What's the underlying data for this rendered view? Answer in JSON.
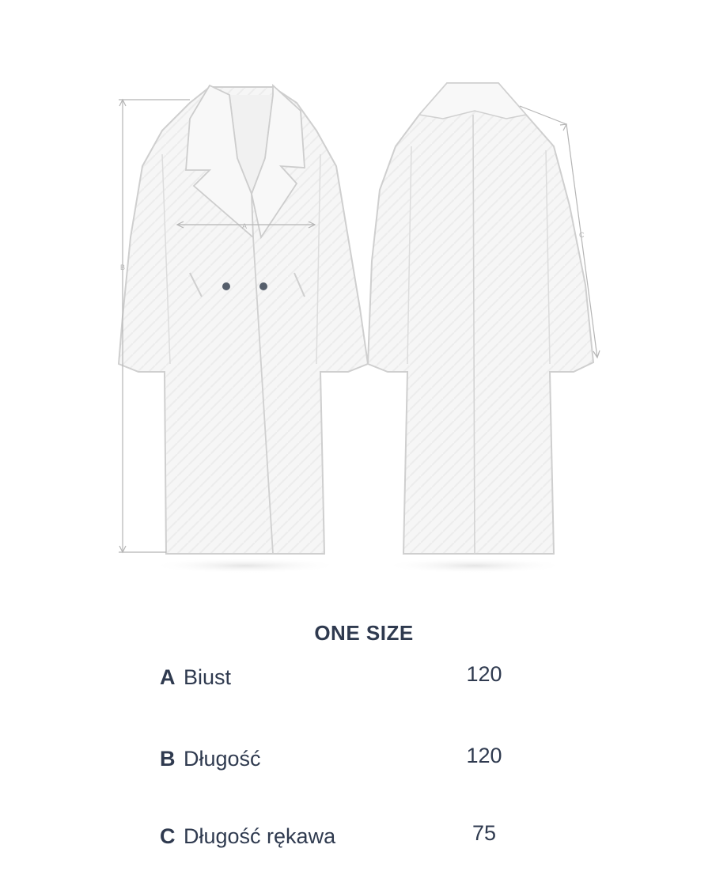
{
  "diagram": {
    "marker_a": "A",
    "marker_b": "B",
    "marker_c": "C"
  },
  "size_title": "ONE SIZE",
  "rows": [
    {
      "letter": "A",
      "label": "Biust",
      "value": "120"
    },
    {
      "letter": "B",
      "label": "Długość",
      "value": "120"
    },
    {
      "letter": "C",
      "label": "Długość rękawa",
      "value": "75"
    }
  ],
  "colors": {
    "text": "#2f3a4f",
    "outline": "#c9c9c9",
    "fabric": "#f7f7f7",
    "measure_line": "#b5b5b5"
  }
}
